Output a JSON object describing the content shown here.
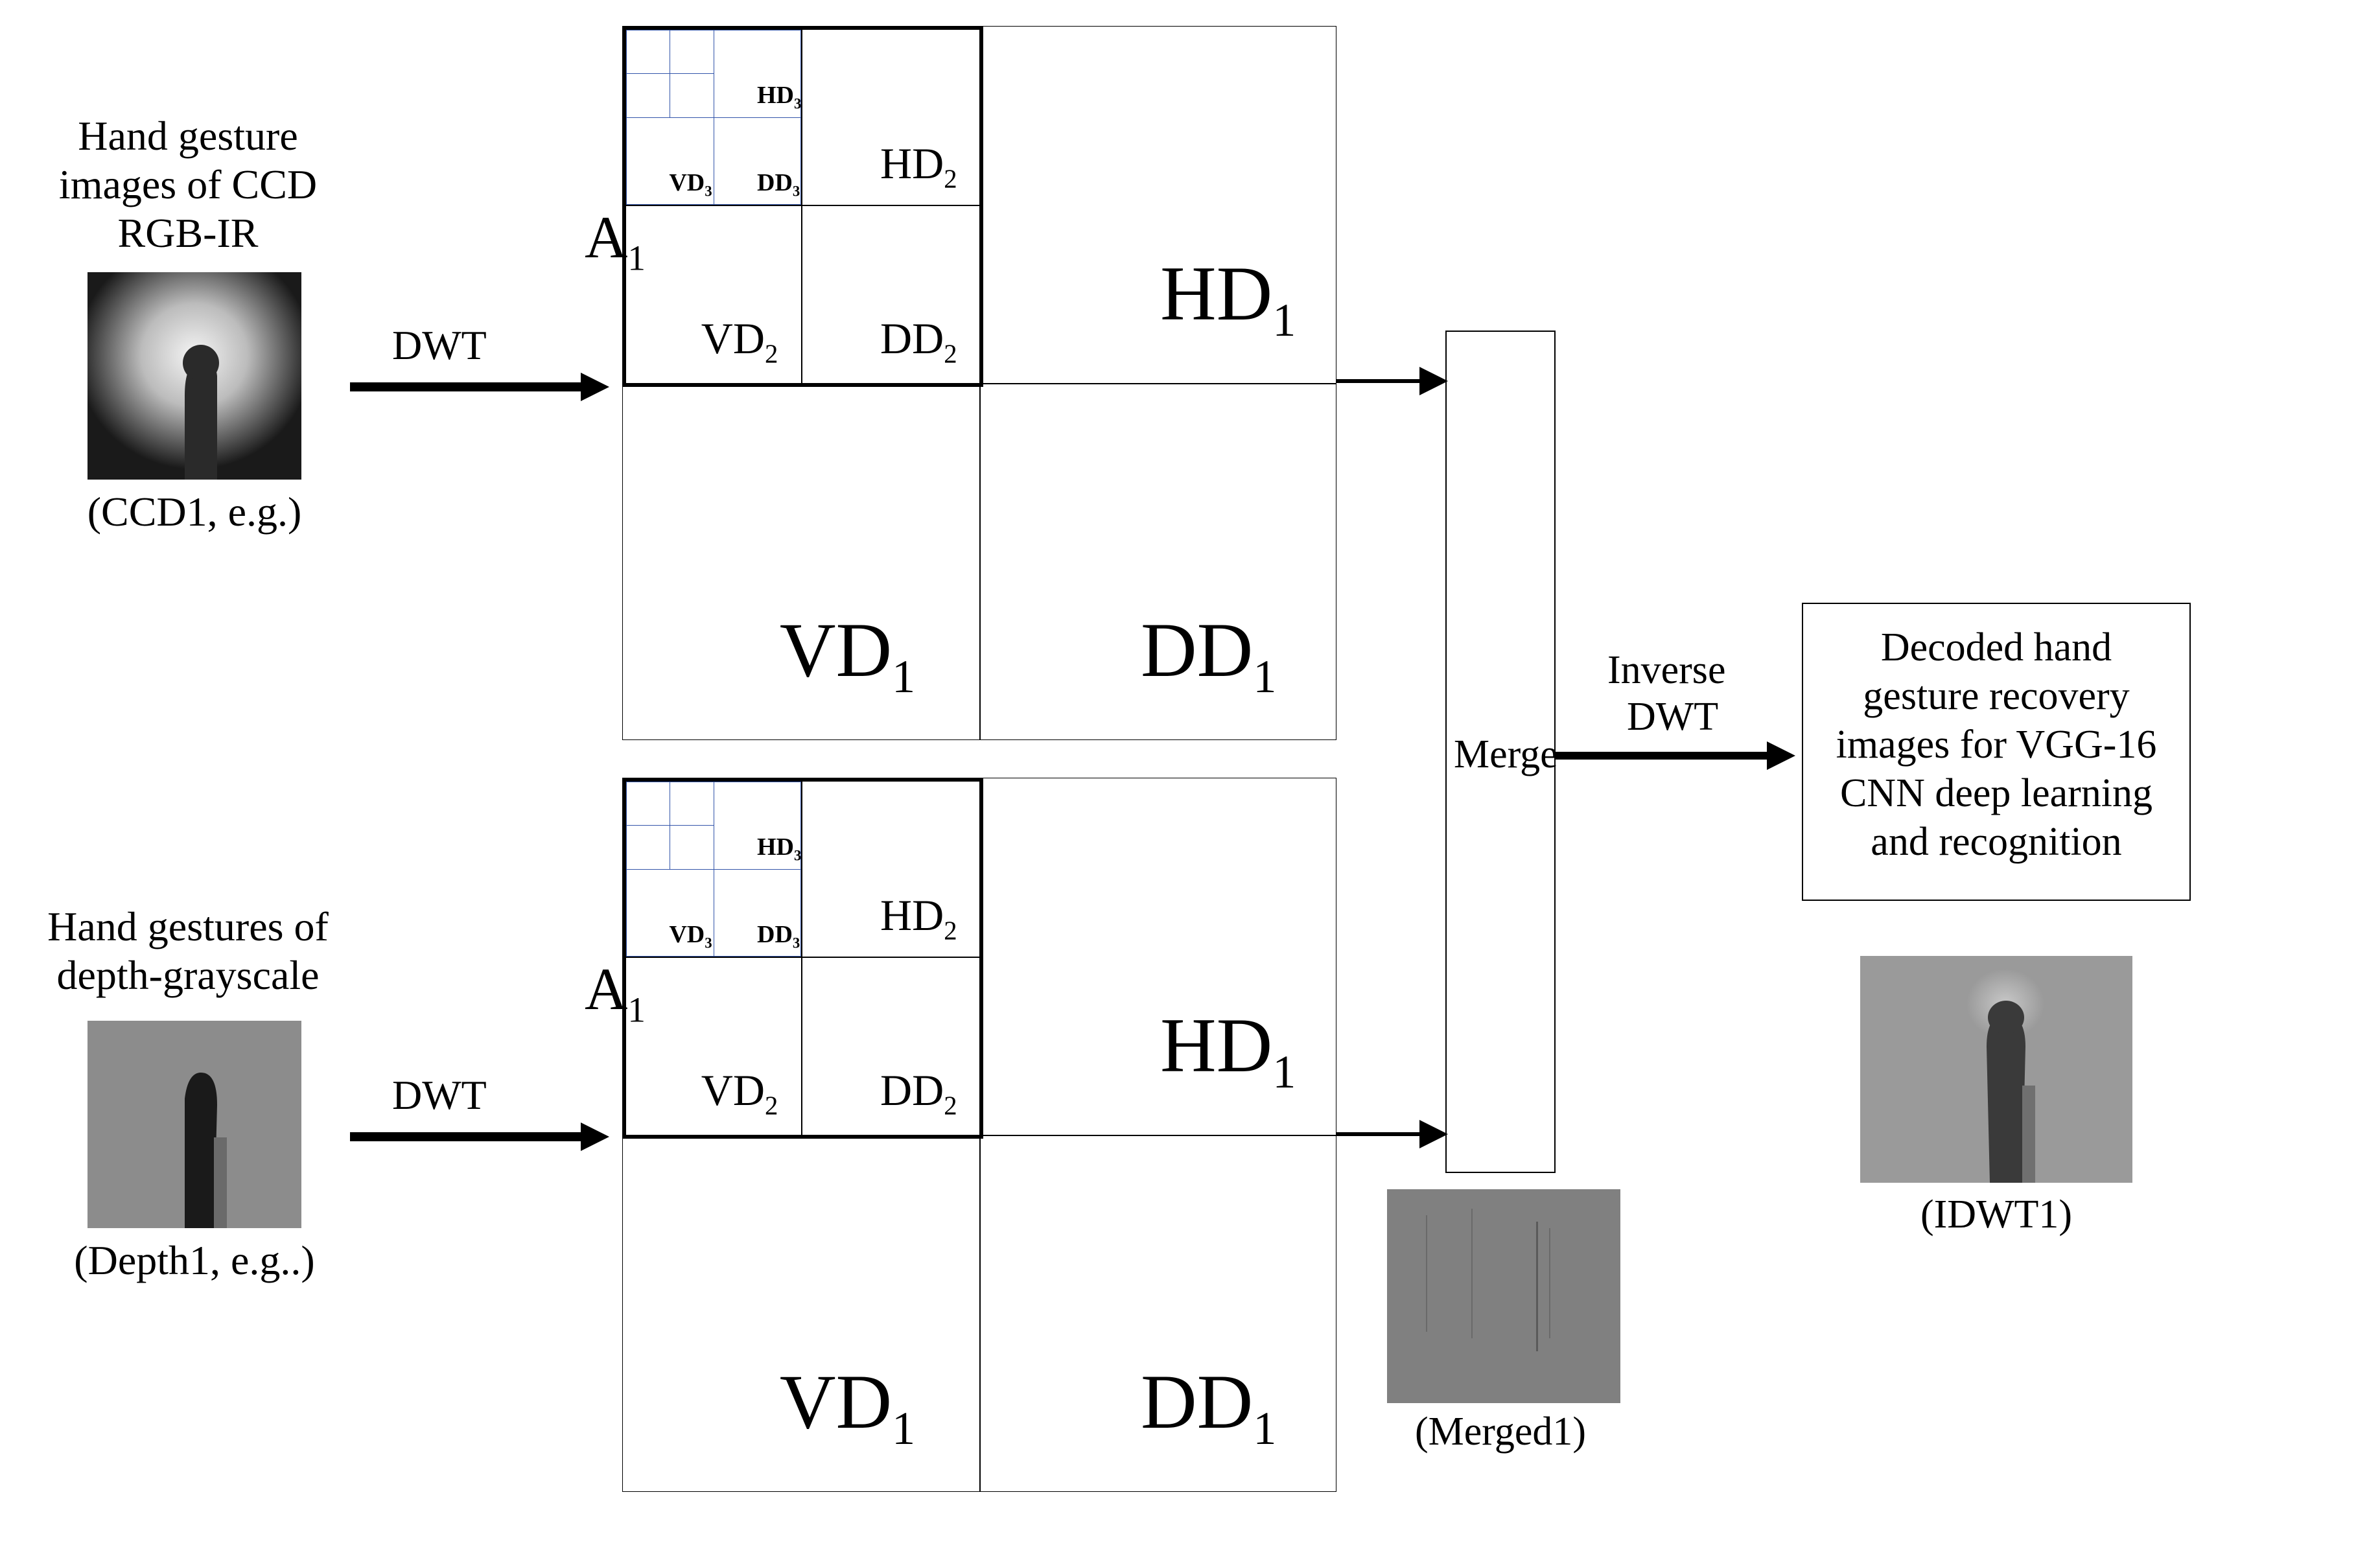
{
  "left_input_top": {
    "title_line1": "Hand gesture",
    "title_line2": "images of CCD",
    "title_line3": "RGB-IR",
    "caption": "(CCD1, e.g.)"
  },
  "left_input_bottom": {
    "title_line1": "Hand gestures of",
    "title_line2": "depth-grayscale",
    "caption": "(Depth1, e.g..)"
  },
  "arrows": {
    "dwt_label": "DWT",
    "inverse_line1": "Inverse",
    "inverse_line2": "DWT"
  },
  "dwt": {
    "A1": "A",
    "A1_sub": "1",
    "HD1": "HD",
    "VD1": "VD",
    "DD1": "DD",
    "sub1": "1",
    "HD2": "HD",
    "VD2": "VD",
    "DD2": "DD",
    "sub2": "2",
    "HD3": "HD",
    "VD3": "VD",
    "DD3": "DD",
    "sub3": "3"
  },
  "merge": {
    "label": "Merge",
    "caption": "(Merged1)"
  },
  "output": {
    "line1": "Decoded hand",
    "line2": "gesture recovery",
    "line3": "images for VGG-16",
    "line4": "CNN deep learning",
    "line5": "and recognition",
    "caption": "(IDWT1)"
  }
}
